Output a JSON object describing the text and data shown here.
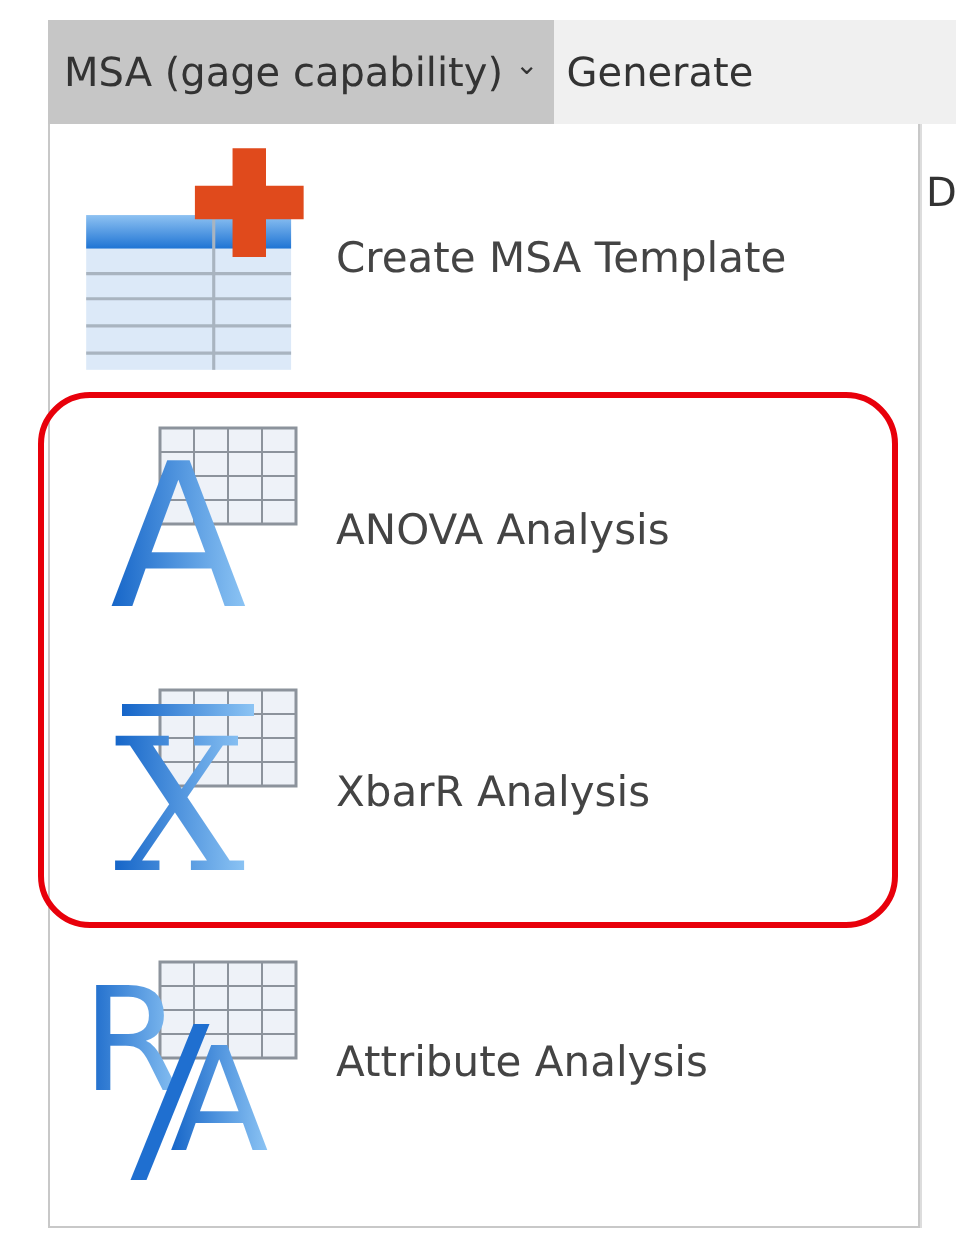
{
  "menu_bar": {
    "items": [
      {
        "label": "MSA (gage capability)",
        "caret": "⌄",
        "selected": true
      },
      {
        "label": "Generate",
        "selected": false
      }
    ]
  },
  "background_sheet": {
    "cell_text": "D"
  },
  "dropdown": {
    "items": [
      {
        "label": "Create MSA Template",
        "kind": "table-plus",
        "highlighted": false
      },
      {
        "label": "ANOVA Analysis",
        "kind": "letter",
        "glyph": "A",
        "highlighted": true
      },
      {
        "label": "XbarR Analysis",
        "kind": "letter-bar",
        "glyph": "X",
        "highlighted": true
      },
      {
        "label": "Attribute Analysis",
        "kind": "letter-pair",
        "glyph": "R",
        "glyph_2": "A",
        "highlighted": false
      }
    ]
  }
}
